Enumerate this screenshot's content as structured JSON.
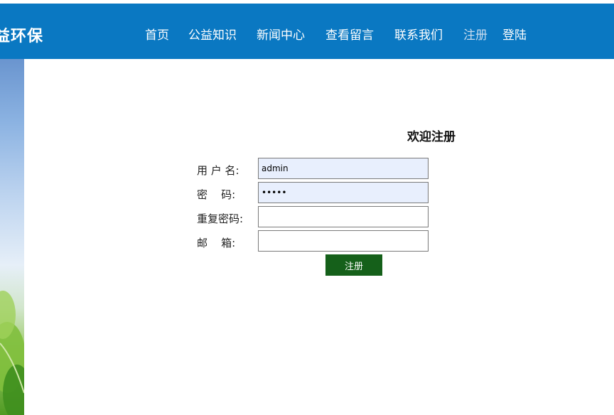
{
  "header": {
    "logo": "益环保",
    "nav": [
      {
        "label": "首页"
      },
      {
        "label": "公益知识"
      },
      {
        "label": "新闻中心"
      },
      {
        "label": "查看留言"
      },
      {
        "label": "联系我们"
      },
      {
        "label": "注册",
        "active": true
      },
      {
        "label": "登陆"
      }
    ],
    "colors": {
      "bar": "#0a78c2",
      "text": "#ffffff",
      "active_text": "#c9dcef"
    }
  },
  "form": {
    "title": "欢迎注册",
    "fields": [
      {
        "label": "用 户 名:",
        "value": "admin",
        "type": "text"
      },
      {
        "label": "密    码:",
        "value": "admin",
        "type": "password"
      },
      {
        "label": "重复密码:",
        "value": "",
        "type": "password"
      },
      {
        "label": "邮    箱:",
        "value": "",
        "type": "text"
      }
    ],
    "submit_label": "注册",
    "colors": {
      "submit": "#15601a",
      "autofill": "#e8effd"
    }
  }
}
